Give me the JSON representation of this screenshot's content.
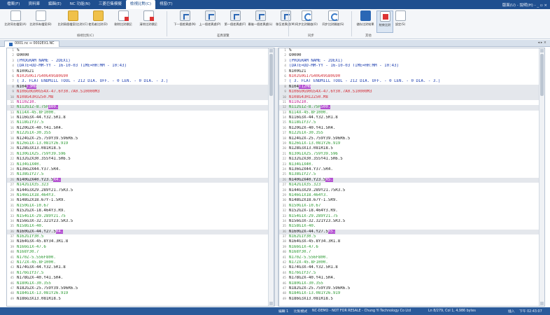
{
  "tabs": [
    "檔案(F)",
    "資料庫",
    "編輯(E)",
    "NC 功能(N)",
    "三菱巨集模擬",
    "檢視比對(C)",
    "視窗(T)"
  ],
  "active_tab_index": 5,
  "tabbar_right": "版面(U) - 說明(H) - _ ▫ ×",
  "ribbon": {
    "buttons": [
      {
        "label": "比對同名檔案(A)",
        "icon": "file-compare-icon"
      },
      {
        "label": "比對所有檔案(B)",
        "icon": "file-compare-all-icon"
      },
      {
        "label": "比對兩個檔案(比對)(C)",
        "icon": "folder-icon"
      },
      {
        "label": "使用者比對(D)",
        "icon": "folder-compare-icon"
      },
      {
        "label": "刪除比對標記",
        "icon": "delete-mark-icon"
      },
      {
        "label": "清除比對標記",
        "icon": "clear-mark-icon"
      },
      {
        "label": "下一個差異處(N)",
        "icon": "next-diff-icon"
      },
      {
        "label": "上一個差異處(P)",
        "icon": "prev-diff-icon"
      },
      {
        "label": "第一個差異處(F)",
        "icon": "first-diff-icon"
      },
      {
        "label": "最後一個差異處(L)",
        "icon": "last-diff-icon"
      },
      {
        "label": "移至差異處(M)",
        "icon": "goto-diff-icon"
      },
      {
        "label": "同步比對開啟(O)",
        "icon": "sync-open-icon"
      },
      {
        "label": "同步比對開啟(S)",
        "icon": "sync-scroll-icon"
      },
      {
        "label": "儲存比對結果",
        "icon": "save-icon"
      },
      {
        "label": "結束比對",
        "icon": "close-compare-icon"
      },
      {
        "label": "設定(S)",
        "icon": "settings-icon"
      }
    ],
    "groups": [
      "檢視比對(C)",
      "差異瀏覽",
      "同步",
      "其他"
    ]
  },
  "doc_tab": {
    "title": "0001.nc ⇔ 0002EX1.NC",
    "right": "◂ ▸ ×"
  },
  "left_lines": [
    {
      "n": "1",
      "t": "%",
      "c": "black"
    },
    {
      "n": "2",
      "t": "O0000",
      "c": "black"
    },
    {
      "n": "3",
      "t": "(PROGRAM NAME - 2DEX1)",
      "c": "blue"
    },
    {
      "n": "4",
      "t": "(DATE=DD-MM-YY - 16-10-03 TIME=HH:MM - 10:43)",
      "c": "blue"
    },
    {
      "n": "5",
      "t": "N100G21",
      "c": "black"
    },
    {
      "n": "6",
      "t": "N102G0G17G40G49G80G90",
      "c": "red"
    },
    {
      "n": "7",
      "t": "( 3. FLAT ENDMILL TOOL - 212 DIA. OFF. - 0 LEN. - 0 DIA. - 3.)",
      "c": "blue"
    },
    {
      "n": "8",
      "t": "N104T3M6",
      "c": "black",
      "hl": true,
      "m": "T3M6"
    },
    {
      "n": "9",
      "t": "N106G0G90G54X-47.6Y30.7A0.S10000M3",
      "c": "red",
      "hl": true
    },
    {
      "n": "10",
      "t": "N108G43H3Z50.M8",
      "c": "red",
      "hl": true
    },
    {
      "n": "11",
      "t": "N110Z10.",
      "c": "magenta"
    },
    {
      "n": "12",
      "t": "N112G1Z-8.75F800.",
      "c": "green",
      "hl": true,
      "m": "800."
    },
    {
      "n": "13",
      "t": "N114X-45.8F1000.",
      "c": "green"
    },
    {
      "n": "14",
      "t": "N116G3X-44.Y32.5R1.8",
      "c": "black"
    },
    {
      "n": "15",
      "t": "N118G1Y37.5",
      "c": "green"
    },
    {
      "n": "16",
      "t": "N120G2X-40.Y41.5R4.",
      "c": "black"
    },
    {
      "n": "17",
      "t": "N122G1X-30.355",
      "c": "green"
    },
    {
      "n": "18",
      "t": "N124G2X-25.759Y39.596R6.5",
      "c": "black"
    },
    {
      "n": "19",
      "t": "N126G1X-13.081Y26.919",
      "c": "green"
    },
    {
      "n": "20",
      "t": "N128G3X13.081R18.5",
      "c": "black"
    },
    {
      "n": "21",
      "t": "N130G1X25.759Y39.596",
      "c": "green"
    },
    {
      "n": "22",
      "t": "N132G2X30.355Y41.5R6.5",
      "c": "black"
    },
    {
      "n": "23",
      "t": "N134G1X40.",
      "c": "green"
    },
    {
      "n": "24",
      "t": "N136G2X44.Y37.5R4.",
      "c": "black"
    },
    {
      "n": "25",
      "t": "N138G1Y27.5",
      "c": "green"
    },
    {
      "n": "26",
      "t": "N140G2X40.Y23.5R4.",
      "c": "black",
      "hl": true,
      "m": "R4."
    },
    {
      "n": "27",
      "t": "N142G1X35.323",
      "c": "green"
    },
    {
      "n": "28",
      "t": "N144G3X29.289Y21.75R3.5",
      "c": "black"
    },
    {
      "n": "29",
      "t": "N146G1X18.464Y3.",
      "c": "green"
    },
    {
      "n": "30",
      "t": "N148G2X18.67Y-1.5R9.",
      "c": "black"
    },
    {
      "n": "31",
      "t": "N150G1X-10.67",
      "c": "green"
    },
    {
      "n": "32",
      "t": "N152G2X-18.464Y3.R9.",
      "c": "black"
    },
    {
      "n": "33",
      "t": "N154G1X-29.289Y21.75",
      "c": "green"
    },
    {
      "n": "34",
      "t": "N156G3X-32.321Y23.5R3.5",
      "c": "black"
    },
    {
      "n": "35",
      "t": "N158G1X-40.",
      "c": "green"
    },
    {
      "n": "36",
      "t": "N160G2X-44.Y27.5R4.",
      "c": "black",
      "hl": true,
      "m": "R4."
    },
    {
      "n": "37",
      "t": "N162G1Y30.5",
      "c": "green"
    },
    {
      "n": "38",
      "t": "N164G3X-45.8Y34.3R1.8",
      "c": "black"
    },
    {
      "n": "39",
      "t": "N166G1X-47.6",
      "c": "green"
    },
    {
      "n": "40",
      "t": "N168Y30.7",
      "c": "green"
    },
    {
      "n": "41",
      "t": "N170Z-5.556F800.",
      "c": "green"
    },
    {
      "n": "42",
      "t": "N172X-45.8F1000.",
      "c": "green"
    },
    {
      "n": "43",
      "t": "N174G3X-44.Y32.5R1.8",
      "c": "black"
    },
    {
      "n": "44",
      "t": "N176G1Y37.5",
      "c": "green"
    },
    {
      "n": "45",
      "t": "N178G2X-40.Y41.5R4.",
      "c": "black"
    },
    {
      "n": "46",
      "t": "N180G1X-30.355",
      "c": "green"
    },
    {
      "n": "47",
      "t": "N182G2X-25.759Y39.596R6.5",
      "c": "black"
    },
    {
      "n": "48",
      "t": "N184G1X-13.081Y26.919",
      "c": "green"
    },
    {
      "n": "49",
      "t": "N186G3X13.081R18.5",
      "c": "black"
    }
  ],
  "right_lines": [
    {
      "n": "1",
      "t": "%",
      "c": "black"
    },
    {
      "n": "2",
      "t": "O0000",
      "c": "black"
    },
    {
      "n": "3",
      "t": "(PROGRAM NAME - 2DEX1)",
      "c": "blue"
    },
    {
      "n": "4",
      "t": "(DATE=DD-MM-YY - 16-10-03 TIME=HH:MM - 10:43)",
      "c": "blue"
    },
    {
      "n": "5",
      "t": "N100G21",
      "c": "black"
    },
    {
      "n": "6",
      "t": "N102G0G17G40G49G80G90",
      "c": "red"
    },
    {
      "n": "7",
      "t": "( 3. FLAT ENDMILL TOOL - 212 DIA. OFF. - 0 LEN. - 0 DIA. - 3.)",
      "c": "blue"
    },
    {
      "n": "8",
      "t": "N104T12M6",
      "c": "black",
      "hl": true,
      "m": "T12M6"
    },
    {
      "n": "9",
      "t": "N106G0G90G54X-47.6Y30.7A0.S10000M3",
      "c": "red",
      "hl": true
    },
    {
      "n": "10",
      "t": "N108G43H12Z50.M8",
      "c": "red",
      "hl": true
    },
    {
      "n": "11",
      "t": "N110Z10.",
      "c": "magenta"
    },
    {
      "n": "12",
      "t": "N112G1Z-8.75F500.",
      "c": "green",
      "hl": true,
      "m": "500."
    },
    {
      "n": "13",
      "t": "N114X-45.8F1000.",
      "c": "green"
    },
    {
      "n": "14",
      "t": "N116G3X-44.Y32.5R1.8",
      "c": "black"
    },
    {
      "n": "15",
      "t": "N118G1Y37.5",
      "c": "green"
    },
    {
      "n": "16",
      "t": "N120G2X-40.Y41.5R4.",
      "c": "black"
    },
    {
      "n": "17",
      "t": "N122G1X-30.355",
      "c": "green"
    },
    {
      "n": "18",
      "t": "N124G2X-25.759Y39.596R6.5",
      "c": "black"
    },
    {
      "n": "19",
      "t": "N126G1X-13.081Y26.919",
      "c": "green"
    },
    {
      "n": "20",
      "t": "N128G3X13.081R18.5",
      "c": "black"
    },
    {
      "n": "21",
      "t": "N130G1X25.759Y39.596",
      "c": "green"
    },
    {
      "n": "22",
      "t": "N132G2X30.355Y41.5R6.5",
      "c": "black"
    },
    {
      "n": "23",
      "t": "N134G1X40.",
      "c": "green"
    },
    {
      "n": "24",
      "t": "N136G2X44.Y37.5R4.",
      "c": "black"
    },
    {
      "n": "25",
      "t": "N138G1Y27.5",
      "c": "green"
    },
    {
      "n": "26",
      "t": "N140G2X40.Y23.5R5.",
      "c": "black",
      "hl": true,
      "m": "R5."
    },
    {
      "n": "27",
      "t": "N142G1X35.323",
      "c": "green"
    },
    {
      "n": "28",
      "t": "N144G3X29.289Y21.75R3.5",
      "c": "black"
    },
    {
      "n": "29",
      "t": "N146G1X18.464Y3.",
      "c": "green"
    },
    {
      "n": "30",
      "t": "N148G2X18.67Y-1.5R9.",
      "c": "black"
    },
    {
      "n": "31",
      "t": "N150G1X-10.67",
      "c": "green"
    },
    {
      "n": "32",
      "t": "N152G2X-18.464Y3.R9.",
      "c": "black"
    },
    {
      "n": "33",
      "t": "N154G1X-29.289Y21.75",
      "c": "green"
    },
    {
      "n": "34",
      "t": "N156G3X-32.321Y23.5R3.5",
      "c": "black"
    },
    {
      "n": "35",
      "t": "N158G1X-40.",
      "c": "green"
    },
    {
      "n": "36",
      "t": "N160G2X-44.Y27.5R5.",
      "c": "black",
      "hl": true,
      "m": "R5."
    },
    {
      "n": "37",
      "t": "N162G1Y30.5",
      "c": "green"
    },
    {
      "n": "38",
      "t": "N164G3X-45.8Y34.3R1.8",
      "c": "black"
    },
    {
      "n": "39",
      "t": "N166G1X-47.6",
      "c": "green"
    },
    {
      "n": "40",
      "t": "N168Y30.7",
      "c": "green"
    },
    {
      "n": "41",
      "t": "N170Z-5.556F800.",
      "c": "green"
    },
    {
      "n": "42",
      "t": "N172X-45.8F1000.",
      "c": "green"
    },
    {
      "n": "43",
      "t": "N174G3X-44.Y32.5R1.8",
      "c": "black"
    },
    {
      "n": "44",
      "t": "N176G1Y37.5",
      "c": "green"
    },
    {
      "n": "45",
      "t": "N178G2X-40.Y41.5R4.",
      "c": "black"
    },
    {
      "n": "46",
      "t": "N180G1X-30.355",
      "c": "green"
    },
    {
      "n": "47",
      "t": "N182G2X-25.759Y39.596R6.5",
      "c": "black"
    },
    {
      "n": "48",
      "t": "N184G1X-13.081Y26.919",
      "c": "green"
    },
    {
      "n": "49",
      "t": "N186G3X13.081R18.5",
      "c": "black"
    }
  ],
  "status": {
    "left": "編輯 1",
    "mode": "比對模式",
    "demo": "NC-DEMO - NOT FOR RESALE - Chung Yi Technology Co Ltd",
    "position": "Ln 8/279, Col 1, 4,986 bytes",
    "ins": "插入",
    "time": "下午 02:43:07"
  },
  "colors": {
    "accent": "#1f4f8f",
    "diff_mark": "#b34fd1",
    "highlight_row": "#e4e7ec"
  }
}
